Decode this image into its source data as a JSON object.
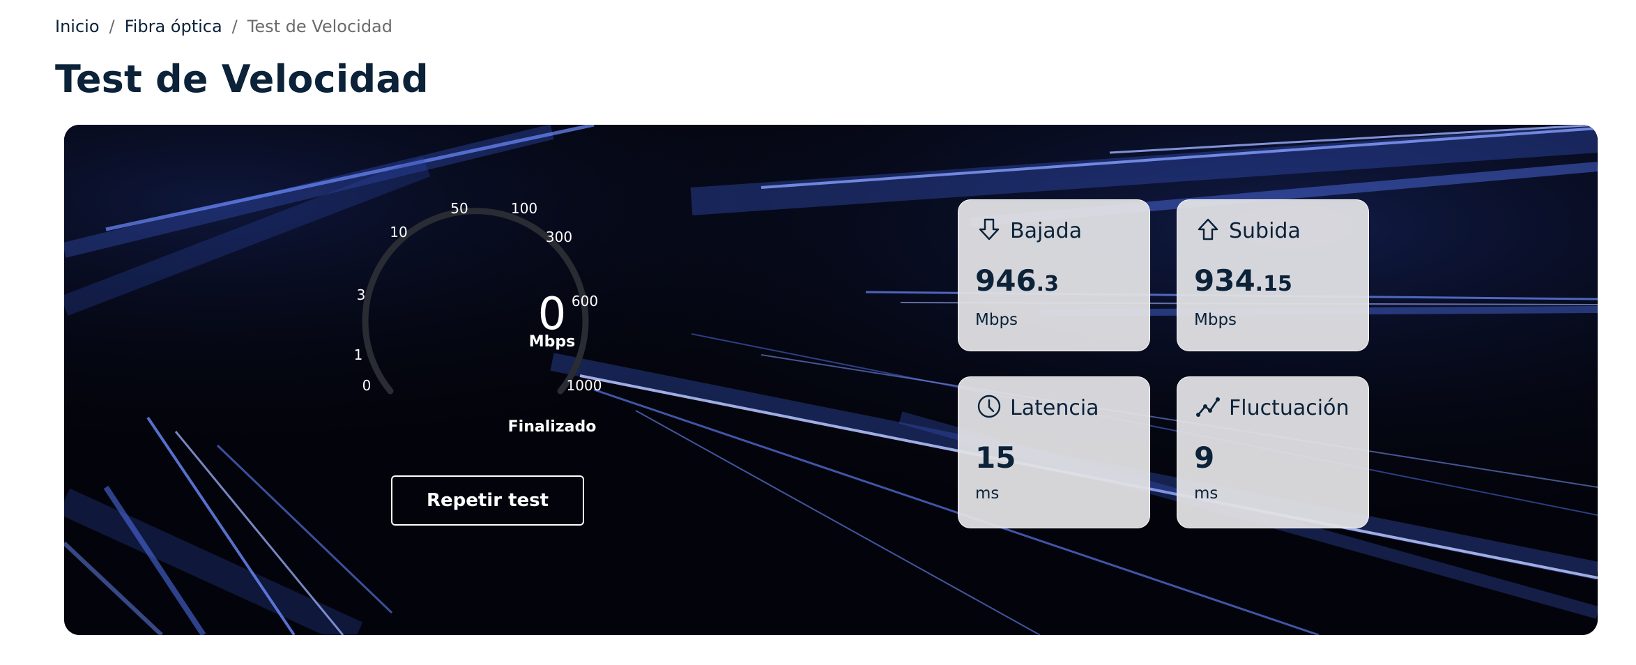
{
  "breadcrumb": {
    "items": [
      "Inicio",
      "Fibra óptica"
    ],
    "current": "Test de Velocidad"
  },
  "page_title": "Test de Velocidad",
  "gauge": {
    "value": "0",
    "unit": "Mbps",
    "ticks": [
      "0",
      "1",
      "3",
      "10",
      "50",
      "100",
      "300",
      "600",
      "1000"
    ],
    "status": "Finalizado"
  },
  "repeat_button": "Repetir test",
  "metrics": {
    "download": {
      "label": "Bajada",
      "value": "946",
      "decimal": ".3",
      "unit": "Mbps",
      "icon": "arrow-down-icon"
    },
    "upload": {
      "label": "Subida",
      "value": "934",
      "decimal": ".15",
      "unit": "Mbps",
      "icon": "arrow-up-icon"
    },
    "latency": {
      "label": "Latencia",
      "value": "15",
      "unit": "ms",
      "icon": "clock-icon"
    },
    "jitter": {
      "label": "Fluctuación",
      "value": "9",
      "unit": "ms",
      "icon": "trend-line-icon"
    }
  },
  "colors": {
    "text_primary": "#0b2239",
    "hero_background": "#03040b",
    "streak_blue": "#3f63d8",
    "card_background": "#e2e2e6"
  }
}
